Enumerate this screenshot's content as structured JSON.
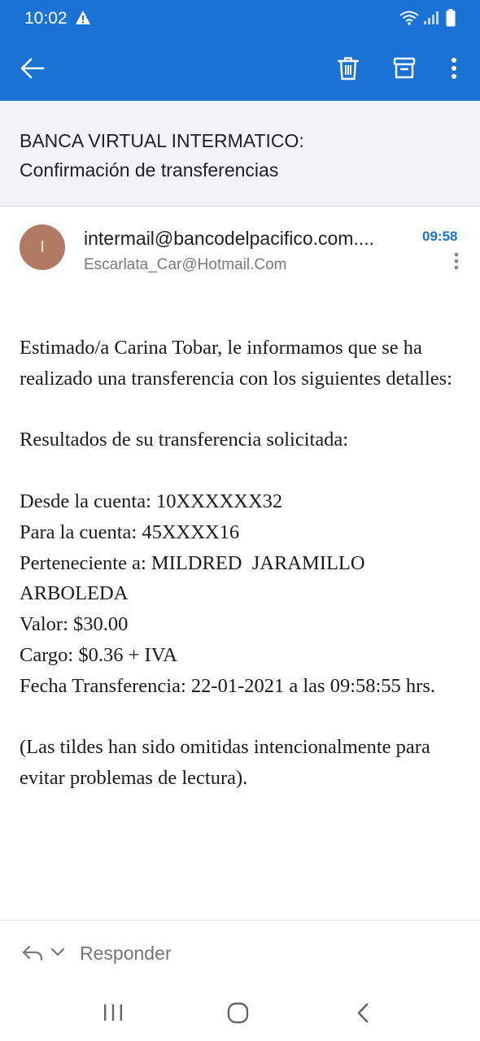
{
  "status_bar": {
    "time": "10:02",
    "icons": [
      "warning-icon",
      "wifi-icon",
      "signal-icon",
      "battery-icon"
    ]
  },
  "app_bar": {
    "color": "#1a73d4",
    "actions": [
      "back-arrow-icon",
      "delete-icon",
      "archive-icon",
      "more-vert-icon"
    ]
  },
  "subject": {
    "line1": "BANCA VIRTUAL INTERMATICO:",
    "line2": "Confirmación de transferencias"
  },
  "message": {
    "avatar_initial": "I",
    "avatar_color": "#b27a64",
    "from": "intermail@bancodelpacifico.com....",
    "to": "Escarlata_Car@Hotmail.Com",
    "time": "09:58",
    "body": {
      "intro": "Estimado/a Carina Tobar, le informamos que se ha realizado una transferencia con los siguientes detalles:",
      "results_heading": "Resultados de su transferencia solicitada:",
      "from_account": "Desde la cuenta: 10XXXXXX32",
      "to_account": "Para la cuenta: 45XXXX16",
      "belongs_to": "Perteneciente a: MILDRED  JARAMILLO ARBOLEDA",
      "amount": "Valor: $30.00",
      "charge": "Cargo: $0.36 + IVA",
      "date": "Fecha Transferencia: 22-01-2021 a las 09:58:55 hrs.",
      "note": "(Las tildes han sido omitidas intencionalmente para evitar problemas de lectura)."
    }
  },
  "reply_bar": {
    "reply_label": "Responder"
  },
  "nav_bar": {
    "buttons": [
      "recent-apps-icon",
      "home-icon",
      "back-icon"
    ]
  }
}
